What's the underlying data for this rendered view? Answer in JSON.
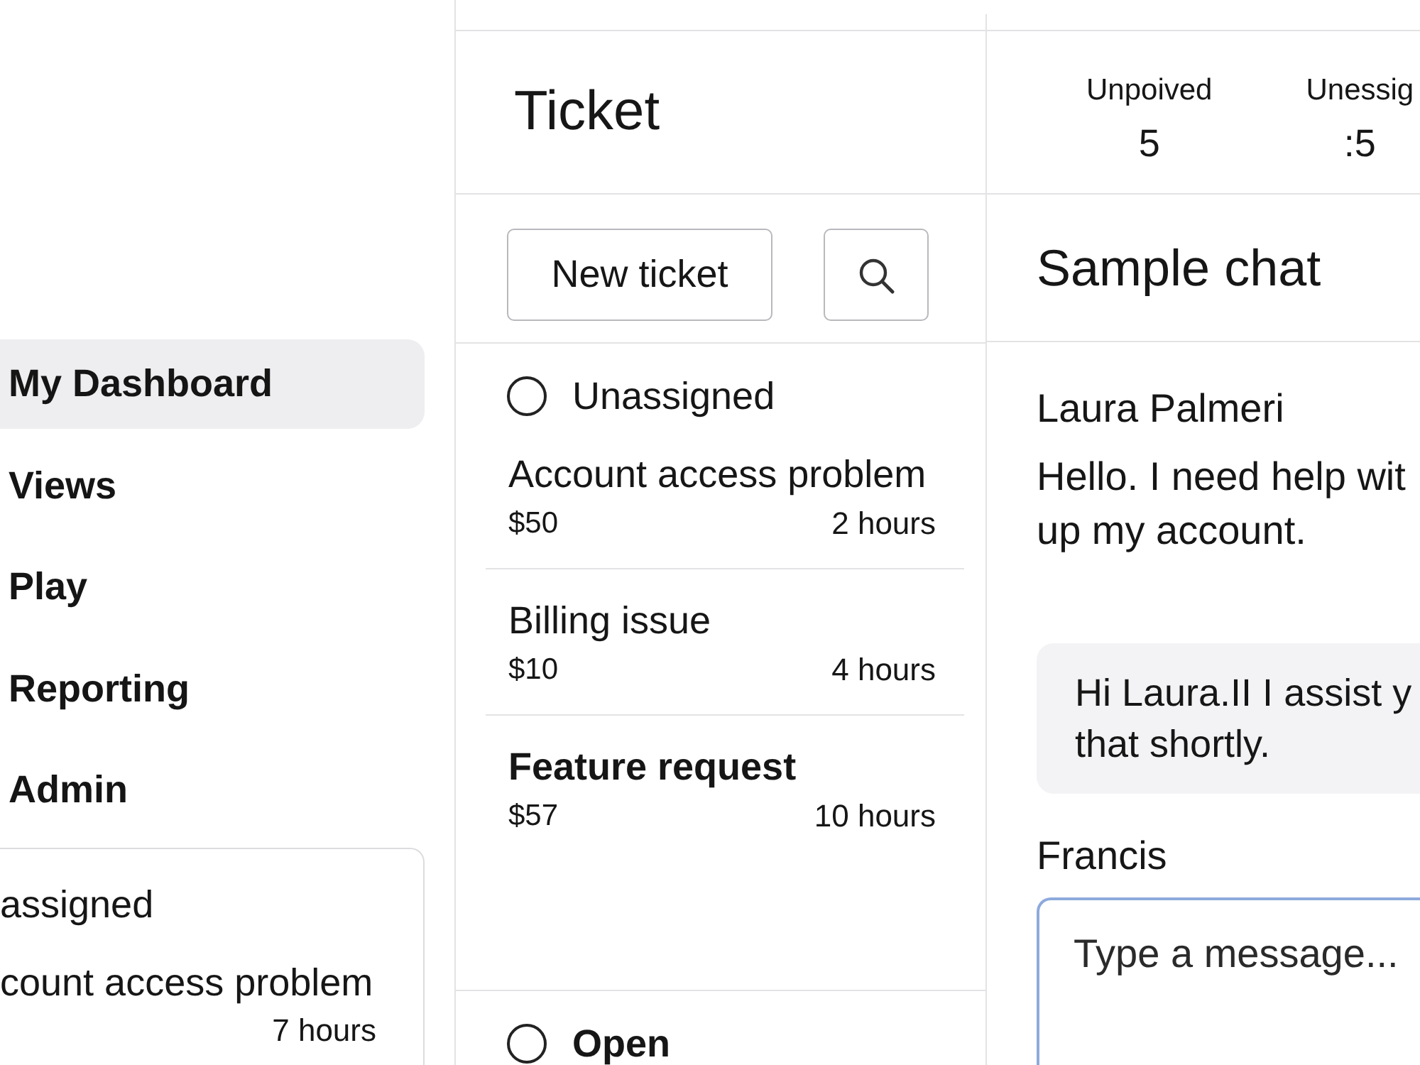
{
  "sidebar": {
    "nav": [
      {
        "label": "My Dashboard",
        "selected": true
      },
      {
        "label": "Views",
        "selected": false
      },
      {
        "label": "Play",
        "selected": false
      },
      {
        "label": "Reporting",
        "selected": false
      },
      {
        "label": "Admin",
        "selected": false
      }
    ],
    "queue_card": {
      "title": "assigned",
      "tickets": [
        {
          "subject": "count access problem",
          "age": "7 hours"
        }
      ]
    }
  },
  "ticket_panel": {
    "title": "Ticket",
    "new_ticket_button": "New ticket",
    "groups": [
      {
        "label": "Unassigned",
        "checked": false,
        "unread": false,
        "tickets": [
          {
            "subject": "Account access problem",
            "amount": "$50",
            "age": "2 hours",
            "unread": false
          },
          {
            "subject": "Billing issue",
            "amount": "$10",
            "age": "4 hours",
            "unread": false
          },
          {
            "subject": "Feature request",
            "amount": "$57",
            "age": "10 hours",
            "unread": true
          }
        ]
      },
      {
        "label": "Open",
        "checked": false,
        "unread": true
      }
    ]
  },
  "stats": [
    {
      "label": "Unpoived",
      "value": "5"
    },
    {
      "label": "Unessig",
      "value": ":5"
    }
  ],
  "chat": {
    "title": "Sample chat",
    "messages": [
      {
        "kind": "plain",
        "sender": "Laura Palmeri",
        "text": "Hello. I need help wit\nup my account."
      },
      {
        "kind": "bubble",
        "text": "Hi Laura.II I assist y\nthat shortly."
      }
    ],
    "composer": {
      "sender": "Francis",
      "placeholder": "Type a message..."
    }
  }
}
